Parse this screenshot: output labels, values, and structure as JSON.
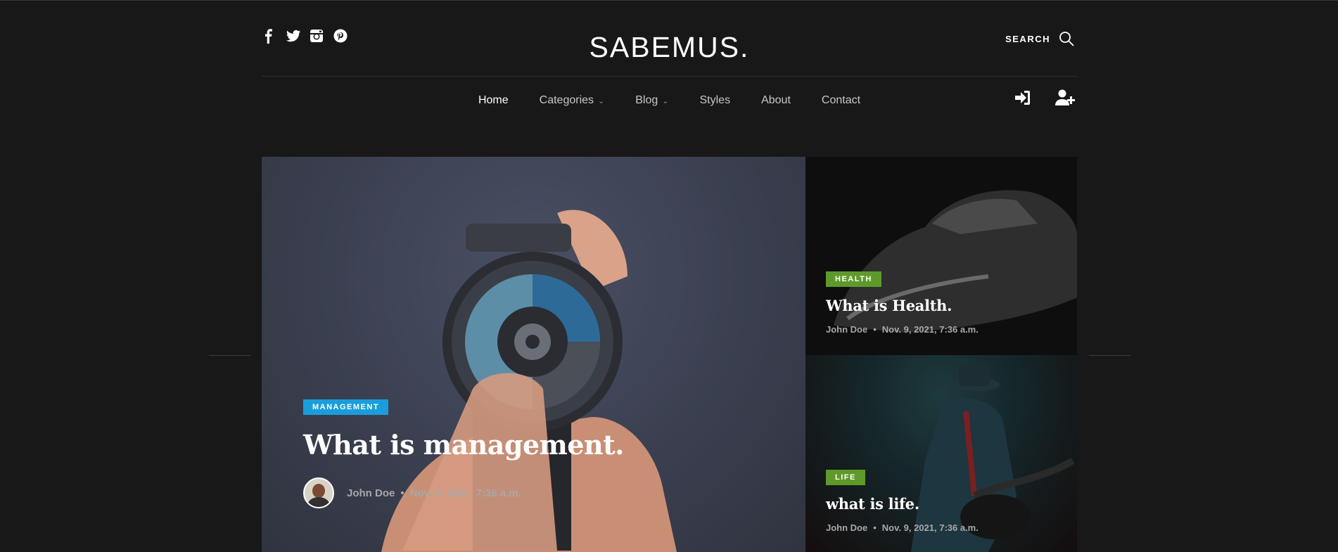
{
  "brand": {
    "logo": "SABEMUS."
  },
  "header": {
    "search_label": "SEARCH"
  },
  "social": [
    "facebook-icon",
    "twitter-icon",
    "instagram-icon",
    "pinterest-icon"
  ],
  "nav": {
    "items": [
      {
        "label": "Home",
        "active": true
      },
      {
        "label": "Categories",
        "dropdown": true
      },
      {
        "label": "Blog",
        "dropdown": true
      },
      {
        "label": "Styles"
      },
      {
        "label": "About"
      },
      {
        "label": "Contact"
      }
    ]
  },
  "account": {
    "icons": [
      "sign-in-icon",
      "user-plus-icon"
    ]
  },
  "colors": {
    "management": "#1a9edb",
    "health": "#5e9a2a",
    "life": "#5e9a2a",
    "background": "#181818"
  },
  "posts": {
    "featured": {
      "category": "MANAGEMENT",
      "title": "What is management.",
      "author": "John Doe",
      "date": "Nov. 9, 2021, 7:36 a.m."
    },
    "side": [
      {
        "category": "HEALTH",
        "title": "What is Health.",
        "author": "John Doe",
        "date": "Nov. 9, 2021, 7:36 a.m."
      },
      {
        "category": "LIFE",
        "title": "what is life.",
        "author": "John Doe",
        "date": "Nov. 9, 2021, 7:36 a.m."
      }
    ]
  }
}
